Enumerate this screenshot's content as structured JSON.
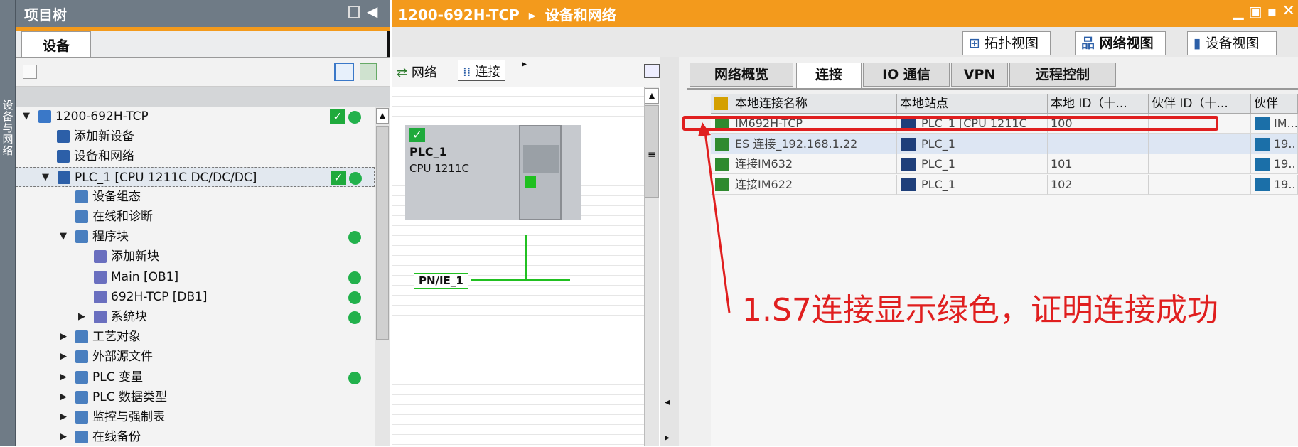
{
  "left_panel": {
    "title": "项目树",
    "tab": "设备",
    "tree": [
      {
        "label": "1200-692H-TCP",
        "level": 0,
        "expanded": true,
        "check": true,
        "status": true
      },
      {
        "label": "添加新设备",
        "level": 1
      },
      {
        "label": "设备和网络",
        "level": 1
      },
      {
        "label": "PLC_1 [CPU 1211C DC/DC/DC]",
        "level": 1,
        "expanded": true,
        "check": true,
        "status": true,
        "selected": true
      },
      {
        "label": "设备组态",
        "level": 2
      },
      {
        "label": "在线和诊断",
        "level": 2
      },
      {
        "label": "程序块",
        "level": 2,
        "expanded": true,
        "status": true
      },
      {
        "label": "添加新块",
        "level": 3
      },
      {
        "label": "Main [OB1]",
        "level": 3,
        "status": true
      },
      {
        "label": "692H-TCP [DB1]",
        "level": 3,
        "status": true
      },
      {
        "label": "系统块",
        "level": 3,
        "collapsed": true,
        "status": true
      },
      {
        "label": "工艺对象",
        "level": 2,
        "collapsed": true
      },
      {
        "label": "外部源文件",
        "level": 2,
        "collapsed": true
      },
      {
        "label": "PLC 变量",
        "level": 2,
        "collapsed": true,
        "status": true
      },
      {
        "label": "PLC 数据类型",
        "level": 2,
        "collapsed": true
      },
      {
        "label": "监控与强制表",
        "level": 2,
        "collapsed": true
      },
      {
        "label": "在线备份",
        "level": 2,
        "collapsed": true
      }
    ]
  },
  "main": {
    "breadcrumb_project": "1200-692H-TCP",
    "breadcrumb_page": "设备和网络",
    "view_buttons": [
      "拓扑视图",
      "网络视图",
      "设备视图"
    ],
    "canvas_toolbar": {
      "network": "网络",
      "connection": "连接"
    },
    "device": {
      "name": "PLC_1",
      "cpu": "CPU 1211C",
      "network": "PN/IE_1"
    }
  },
  "right_panel": {
    "tabs": [
      "网络概览",
      "连接",
      "IO 通信",
      "VPN",
      "远程控制"
    ],
    "columns": [
      "本地连接名称",
      "本地站点",
      "本地 ID（十...",
      "伙伴 ID（十...",
      "伙伴"
    ],
    "rows": [
      {
        "name": "IM692H-TCP",
        "station": "PLC_1 [CPU 1211C",
        "local_id": "100",
        "partner_id": "",
        "partner": "IM..."
      },
      {
        "name": "ES 连接_192.168.1.22",
        "station": "PLC_1",
        "local_id": "",
        "partner_id": "",
        "partner": "19..."
      },
      {
        "name": "连接IM632",
        "station": "PLC_1",
        "local_id": "101",
        "partner_id": "",
        "partner": "19..."
      },
      {
        "name": "连接IM622",
        "station": "PLC_1",
        "local_id": "102",
        "partner_id": "",
        "partner": "19..."
      }
    ]
  },
  "annotation": "1.S7连接显示绿色，证明连接成功",
  "colors": {
    "orange": "#f39a1c",
    "green": "#22b14c",
    "red": "#e01f1f",
    "gray_bar": "#6f7b86"
  }
}
